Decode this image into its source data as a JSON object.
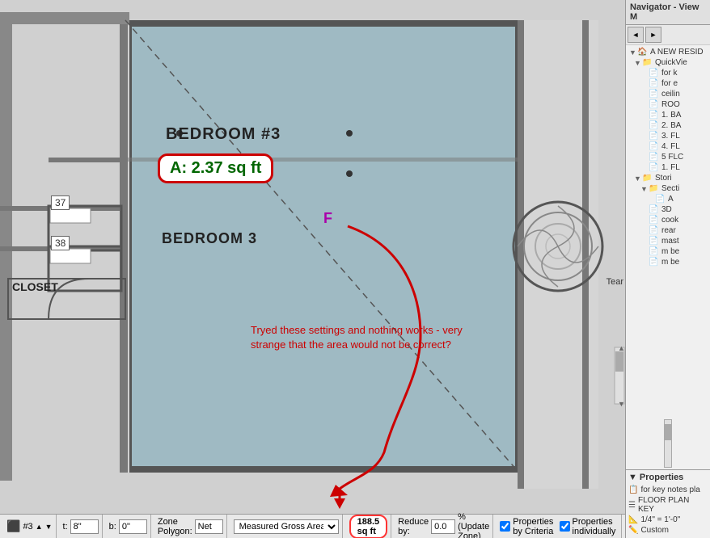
{
  "navigator": {
    "title": "Navigator - View M",
    "toolbar": {
      "btn1": "◄",
      "btn2": "►"
    },
    "tree": [
      {
        "indent": 0,
        "expand": "▼",
        "icon": "🏠",
        "label": "A NEW RESID"
      },
      {
        "indent": 1,
        "expand": "▼",
        "icon": "📁",
        "label": "QuickVie"
      },
      {
        "indent": 2,
        "expand": "",
        "icon": "📄",
        "label": "for k"
      },
      {
        "indent": 2,
        "expand": "",
        "icon": "📄",
        "label": "for e"
      },
      {
        "indent": 2,
        "expand": "",
        "icon": "📄",
        "label": "ceilin"
      },
      {
        "indent": 2,
        "expand": "",
        "icon": "📄",
        "label": "ROO"
      },
      {
        "indent": 2,
        "expand": "",
        "icon": "📄",
        "label": "1. BA"
      },
      {
        "indent": 2,
        "expand": "",
        "icon": "📄",
        "label": "2. BA"
      },
      {
        "indent": 2,
        "expand": "",
        "icon": "📄",
        "label": "3. FL"
      },
      {
        "indent": 2,
        "expand": "",
        "icon": "📄",
        "label": "4. FL"
      },
      {
        "indent": 2,
        "expand": "",
        "icon": "📄",
        "label": "5 FLC"
      },
      {
        "indent": 2,
        "expand": "",
        "icon": "📄",
        "label": "1. FL"
      },
      {
        "indent": 1,
        "expand": "▼",
        "icon": "📁",
        "label": "Stori"
      },
      {
        "indent": 2,
        "expand": "▼",
        "icon": "📁",
        "label": "Secti"
      },
      {
        "indent": 3,
        "expand": "",
        "icon": "📄",
        "label": "A"
      },
      {
        "indent": 2,
        "expand": "",
        "icon": "📄",
        "label": "3D"
      },
      {
        "indent": 2,
        "expand": "",
        "icon": "📄",
        "label": "cook"
      },
      {
        "indent": 2,
        "expand": "",
        "icon": "📄",
        "label": "rear"
      },
      {
        "indent": 2,
        "expand": "",
        "icon": "📄",
        "label": "mast"
      },
      {
        "indent": 2,
        "expand": "",
        "icon": "📄",
        "label": "m be"
      },
      {
        "indent": 2,
        "expand": "",
        "icon": "📄",
        "label": "m be"
      }
    ],
    "properties": {
      "title": "Properties",
      "items": [
        {
          "icon": "📋",
          "label": "for key notes pla"
        },
        {
          "icon": "☰",
          "label": "FLOOR PLAN KEY"
        },
        {
          "icon": "📐",
          "label": "1/4\" = 1'-0\""
        },
        {
          "icon": "✏️",
          "label": "Custom"
        }
      ]
    }
  },
  "floorplan": {
    "room_label_1": "BEDROOM #3",
    "room_label_2": "BEDROOM 3",
    "area_display": "A: 2.37 sq ft",
    "f_marker": "F",
    "closet_label": "CLOSET",
    "number_37": "37",
    "number_38": "38",
    "annotation": "Tryed these settings and nothing works - very strange that the area would not be correct?",
    "tear_label": "Tear"
  },
  "statusbar": {
    "room_id": "#3",
    "t_label": "t:",
    "t_value": "8\"",
    "b_label": "b:",
    "b_value": "0\"",
    "zone_label": "Zone Polygon:",
    "zone_value": "Net",
    "measure_dropdown": "Measured Gross Area",
    "reduce_label": "Reduce by:",
    "reduce_value": "0.0",
    "reduce_suffix": "% (Update Zone)",
    "checkbox1_label": "Properties by Criteria",
    "checkbox2_label": "Properties individually",
    "area_value": "188.5 sq ft",
    "checkbox1_checked": true,
    "checkbox2_checked": true
  }
}
